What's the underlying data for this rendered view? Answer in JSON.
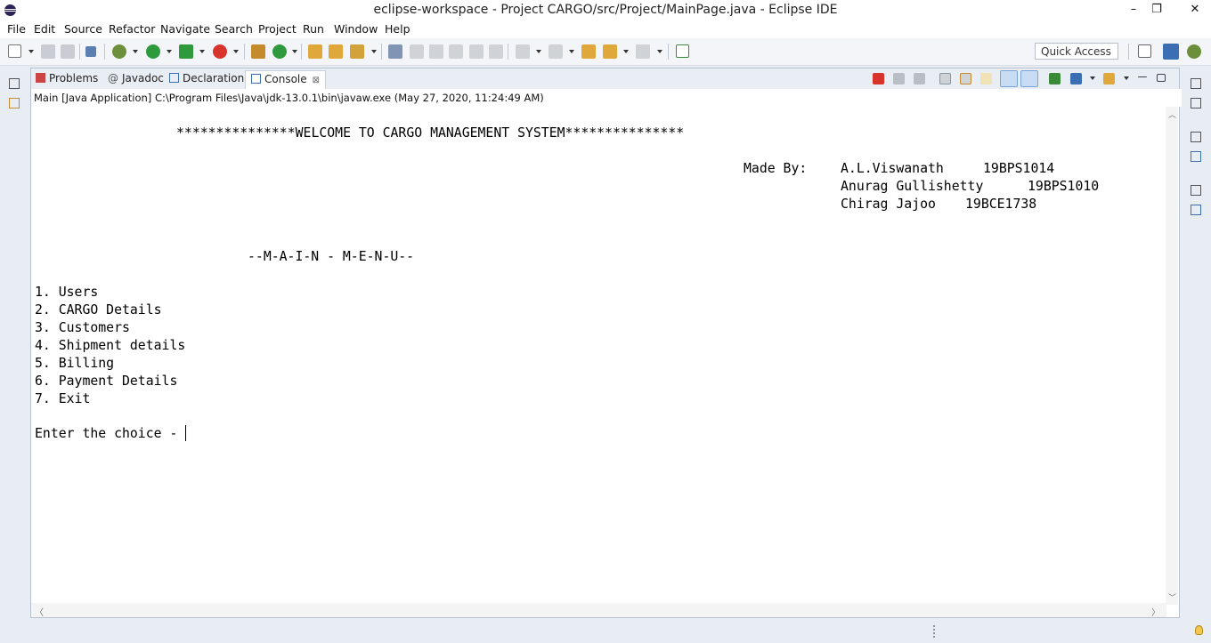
{
  "window": {
    "title": "eclipse-workspace - Project CARGO/src/Project/MainPage.java - Eclipse IDE",
    "minimize": "–",
    "restore": "❐",
    "close": "✕"
  },
  "menu": [
    "File",
    "Edit",
    "Source",
    "Refactor",
    "Navigate",
    "Search",
    "Project",
    "Run",
    "Window",
    "Help"
  ],
  "toolbar": {
    "quick_access": "Quick Access"
  },
  "tabs": [
    {
      "label": "Problems",
      "icon": "problems-icon"
    },
    {
      "label": "Javadoc",
      "icon": "javadoc-icon",
      "glyph": "@"
    },
    {
      "label": "Declaration",
      "icon": "declaration-icon"
    },
    {
      "label": "Console",
      "icon": "console-icon",
      "active": true,
      "close": "⊠"
    }
  ],
  "console": {
    "launch": "Main [Java Application] C:\\Program Files\\Java\\jdk-13.0.1\\bin\\javaw.exe (May 27, 2020, 11:24:49 AM)",
    "welcome": "***************WELCOME TO CARGO MANAGEMENT SYSTEM***************",
    "made_by_label": "Made By:",
    "authors": [
      {
        "name": "A.L.Viswanath",
        "id": "19BPS1014"
      },
      {
        "name": "Anurag Gullishetty",
        "id": "19BPS1010"
      },
      {
        "name": "Chirag Jajoo",
        "id": "19BCE1738"
      }
    ],
    "menu_title": "--M-A-I-N - M-E-N-U--",
    "menu_items": [
      "1. Users",
      "2. CARGO Details",
      "3. Customers",
      "4. Shipment details",
      "5. Billing",
      "6. Payment Details",
      "7. Exit"
    ],
    "prompt": "Enter the choice - "
  },
  "colors": {
    "terminate": "#d9342b",
    "accent": "#3c6eb4",
    "panel_border": "#b8c2cf"
  }
}
